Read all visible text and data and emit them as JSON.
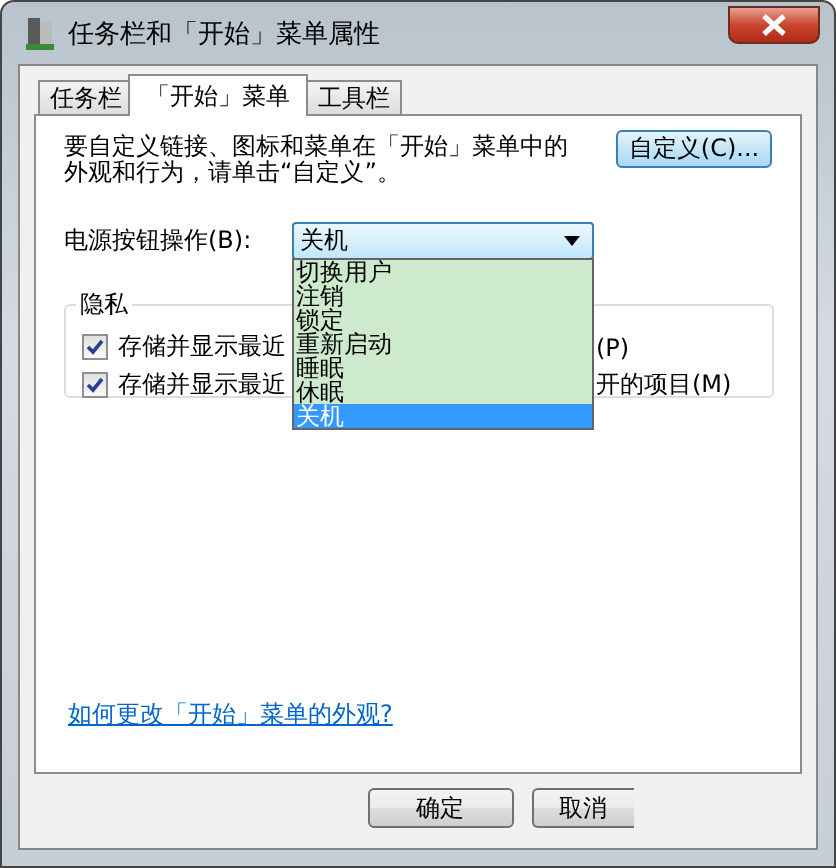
{
  "window": {
    "title": "任务栏和「开始」菜单属性"
  },
  "tabs": [
    {
      "label": "任务栏",
      "selected": false
    },
    {
      "label": "「开始」菜单",
      "selected": true
    },
    {
      "label": "工具栏",
      "selected": false
    }
  ],
  "description": "要自定义链接、图标和菜单在「开始」菜单中的外观和行为，请单击“自定义”。",
  "customize_button": "自定义(C)...",
  "power_button": {
    "label": "电源按钮操作(B):",
    "value": "关机",
    "expanded": true,
    "options": [
      {
        "label": "切换用户",
        "selected": false
      },
      {
        "label": "注销",
        "selected": false
      },
      {
        "label": "锁定",
        "selected": false
      },
      {
        "label": "重新启动",
        "selected": false
      },
      {
        "label": "睡眠",
        "selected": false
      },
      {
        "label": "休眠",
        "selected": false
      },
      {
        "label": "关机",
        "selected": true
      }
    ]
  },
  "privacy": {
    "title": "隐私",
    "checkboxes": [
      {
        "label_start": "存储并显示最近",
        "label_end": "(P)",
        "checked": true
      },
      {
        "label_start": "存储并显示最近",
        "label_end": "开的项目(M)",
        "checked": true
      }
    ]
  },
  "help_link": "如何更改「开始」菜单的外观?",
  "buttons": [
    "确定",
    "取消"
  ]
}
